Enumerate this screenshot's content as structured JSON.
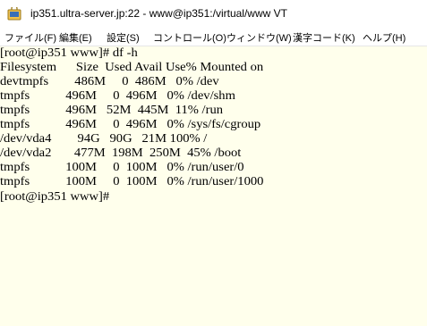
{
  "window": {
    "title": "ip351.ultra-server.jp:22 - www@ip351:/virtual/www VT"
  },
  "menu": {
    "items": [
      "ファイル(F)",
      "編集(E)",
      "設定(S)",
      "コントロール(O)",
      "ウィンドウ(W)",
      "漢字コード(K)",
      "ヘルプ(H)"
    ]
  },
  "terminal": {
    "lines": [
      "[root@ip351 www]# df -h",
      "Filesystem      Size  Used Avail Use% Mounted on",
      "devtmpfs        486M     0  486M   0% /dev",
      "tmpfs           496M     0  496M   0% /dev/shm",
      "tmpfs           496M   52M  445M  11% /run",
      "tmpfs           496M     0  496M   0% /sys/fs/cgroup",
      "/dev/vda4        94G   90G   21M 100% /",
      "/dev/vda2       477M  198M  250M  45% /boot",
      "tmpfs           100M     0  100M   0% /run/user/0",
      "tmpfs           100M     0  100M   0% /run/user/1000",
      "[root@ip351 www]# "
    ],
    "background": "#ffffec",
    "foreground": "#000000"
  },
  "icons": {
    "app": "padlock-terminal-icon"
  }
}
